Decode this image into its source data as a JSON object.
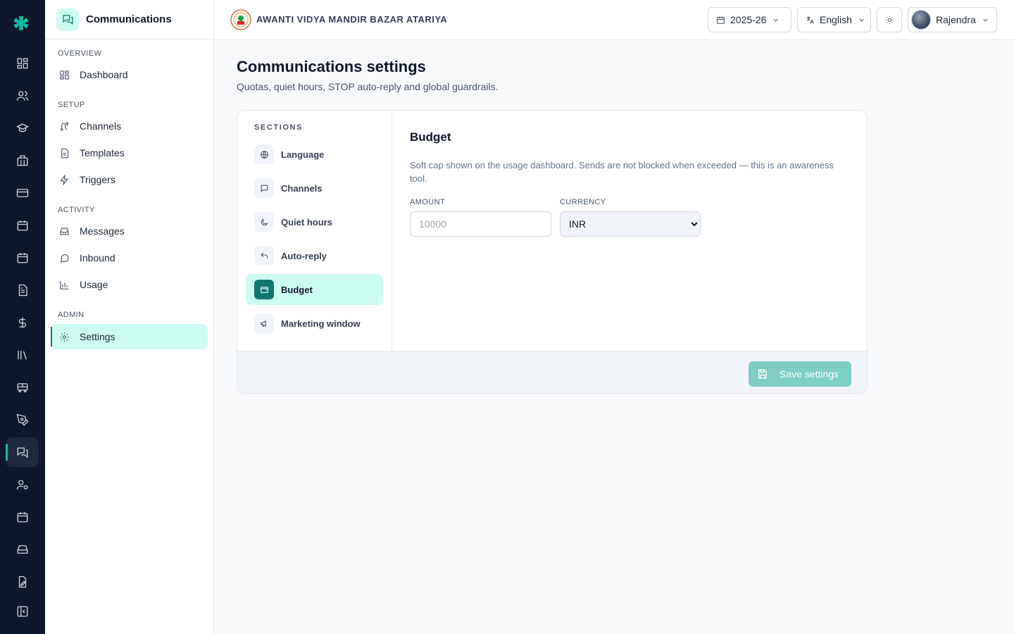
{
  "rail": {
    "items": [
      {
        "icon": "dashboard-icon"
      },
      {
        "icon": "users-icon"
      },
      {
        "icon": "graduation-cap-icon"
      },
      {
        "icon": "building-icon"
      },
      {
        "icon": "credit-card-icon"
      },
      {
        "icon": "calendar-icon"
      },
      {
        "icon": "calendar-check-icon"
      },
      {
        "icon": "file-text-icon"
      },
      {
        "icon": "dollar-icon"
      },
      {
        "icon": "library-icon"
      },
      {
        "icon": "bus-icon"
      },
      {
        "icon": "pen-tool-icon"
      },
      {
        "icon": "messages-icon",
        "active": true
      },
      {
        "icon": "user-cog-icon"
      },
      {
        "icon": "calendar-grid-icon"
      },
      {
        "icon": "inbox-tray-icon"
      },
      {
        "icon": "document-edit-icon"
      },
      {
        "icon": "collapse-sidebar-icon"
      }
    ]
  },
  "sidebar": {
    "title": "Communications",
    "groups": {
      "overview": "OVERVIEW",
      "setup": "SETUP",
      "activity": "ACTIVITY",
      "admin": "ADMIN"
    },
    "items": {
      "dashboard": "Dashboard",
      "channels": "Channels",
      "templates": "Templates",
      "triggers": "Triggers",
      "messages": "Messages",
      "inbound": "Inbound",
      "usage": "Usage",
      "settings": "Settings"
    },
    "active": "settings"
  },
  "topbar": {
    "school_name": "AWANTI VIDYA MANDIR BAZAR ATARIYA",
    "year": "2025-26",
    "language": "English",
    "user": "Rajendra"
  },
  "page": {
    "title": "Communications settings",
    "subtitle": "Quotas, quiet hours, STOP auto-reply and global guardrails."
  },
  "sections": {
    "heading": "SECTIONS",
    "items": [
      {
        "label": "Language",
        "icon": "globe-icon"
      },
      {
        "label": "Channels",
        "icon": "chat-square-icon"
      },
      {
        "label": "Quiet hours",
        "icon": "moon-icon"
      },
      {
        "label": "Auto-reply",
        "icon": "reply-icon"
      },
      {
        "label": "Budget",
        "icon": "wallet-icon",
        "active": true
      },
      {
        "label": "Marketing window",
        "icon": "megaphone-icon"
      }
    ]
  },
  "budget": {
    "title": "Budget",
    "description": "Soft cap shown on the usage dashboard. Sends are not blocked when exceeded — this is an awareness tool.",
    "amount_label": "AMOUNT",
    "amount_placeholder": "10000",
    "amount_value": "",
    "currency_label": "CURRENCY",
    "currency_value": "INR"
  },
  "footer": {
    "save_label": "Save settings"
  },
  "colors": {
    "rail_bg": "#0f172a",
    "accent": "#0f766e",
    "accent_soft": "#ccfbf1",
    "save_disabled": "#7fcdc3"
  }
}
